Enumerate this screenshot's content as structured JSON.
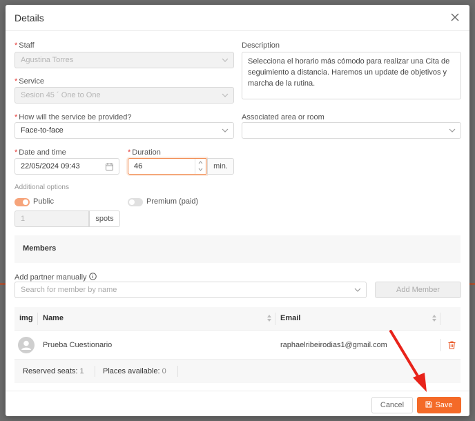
{
  "modal": {
    "title": "Details"
  },
  "form": {
    "staff": {
      "label": "Staff",
      "value": "Agustina Torres"
    },
    "service": {
      "label": "Service",
      "value": "Sesion 45 ´ One to One"
    },
    "provision": {
      "label": "How will the service be provided?",
      "value": "Face-to-face"
    },
    "datetime": {
      "label": "Date and time",
      "value": "22/05/2024 09:43"
    },
    "duration": {
      "label": "Duration",
      "value": "46",
      "unit": "min."
    },
    "description": {
      "label": "Description",
      "value": "Selecciona el horario más cómodo para realizar una Cita de seguimiento a distancia. Haremos un update de objetivos y marcha de la rutina."
    },
    "area": {
      "label": "Associated area or room",
      "value": ""
    }
  },
  "options": {
    "title": "Additional options",
    "public_label": "Public",
    "public_on": true,
    "premium_label": "Premium (paid)",
    "premium_on": false,
    "spots_value": "1",
    "spots_label": "spots"
  },
  "members": {
    "title": "Members",
    "add_label": "Add partner manually",
    "search_placeholder": "Search for member by name",
    "add_button": "Add Member",
    "columns": {
      "img": "img",
      "name": "Name",
      "email": "Email"
    },
    "rows": [
      {
        "name": "Prueba Cuestionario",
        "email": "raphaelribeirodias1@gmail.com"
      }
    ],
    "reserved_label": "Reserved seats:",
    "reserved_value": "1",
    "available_label": "Places available:",
    "available_value": "0"
  },
  "footer": {
    "cancel": "Cancel",
    "save": "Save"
  },
  "colors": {
    "accent": "#f46a28",
    "annotation_arrow": "#e8231a"
  },
  "icons": [
    "close-icon",
    "chevron-down-icon",
    "calendar-icon",
    "info-icon",
    "sort-icon",
    "avatar-icon",
    "trash-icon",
    "save-icon",
    "arrow-annotation"
  ]
}
